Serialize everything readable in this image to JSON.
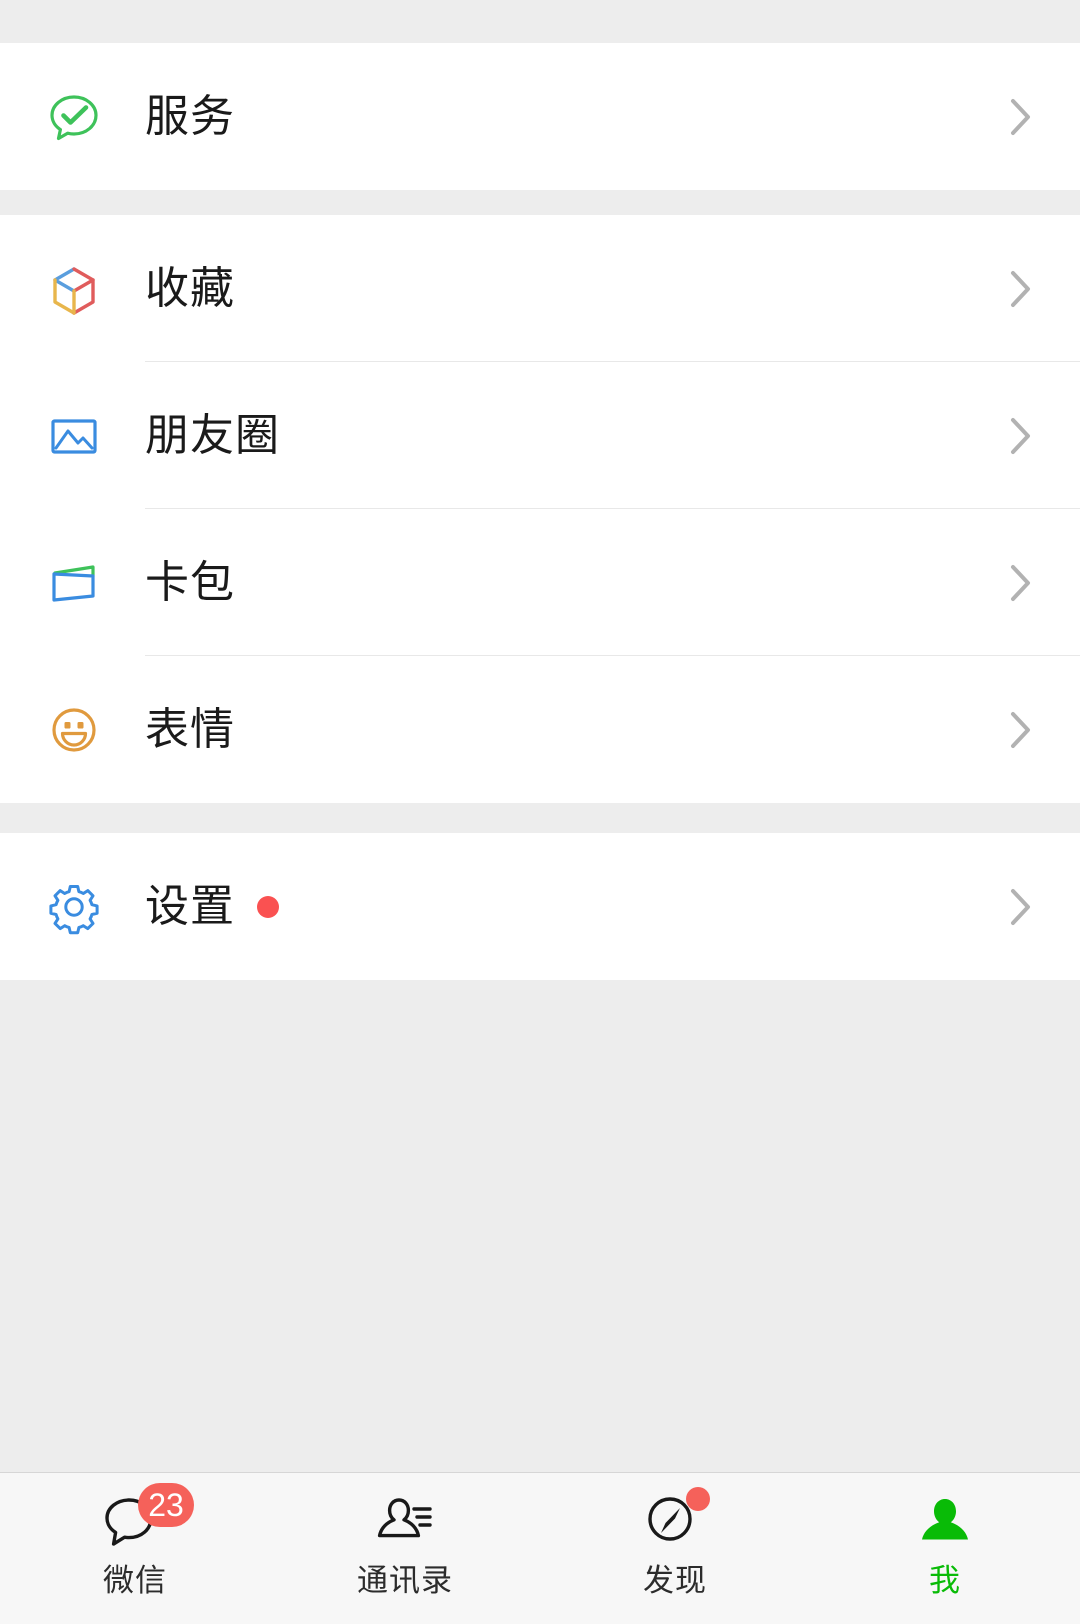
{
  "colors": {
    "page_background": "#ededed",
    "card_background": "#ffffff",
    "accent_green": "#09bb07",
    "badge_red": "#f5615a",
    "dot_red": "#fa5151",
    "icon_blue": "#3a8ce0",
    "icon_orange": "#e09a3e",
    "label_text": "#1a1a1a",
    "chevron_gray": "#b2b2b2"
  },
  "groups": [
    {
      "name": "services-group",
      "items": [
        {
          "id": "services",
          "label": "服务",
          "icon": "wechat-pay-services-icon",
          "has_chevron": true,
          "has_dot": false
        }
      ]
    },
    {
      "name": "features-group",
      "items": [
        {
          "id": "favorites",
          "label": "收藏",
          "icon": "cube-favorites-icon",
          "has_chevron": true,
          "has_dot": false
        },
        {
          "id": "moments",
          "label": "朋友圈",
          "icon": "photo-moments-icon",
          "has_chevron": true,
          "has_dot": false
        },
        {
          "id": "cards-offers",
          "label": "卡包",
          "icon": "wallet-cards-icon",
          "has_chevron": true,
          "has_dot": false
        },
        {
          "id": "stickers",
          "label": "表情",
          "icon": "smiley-stickers-icon",
          "has_chevron": true,
          "has_dot": false
        }
      ]
    },
    {
      "name": "settings-group",
      "items": [
        {
          "id": "settings",
          "label": "设置",
          "icon": "gear-settings-icon",
          "has_chevron": true,
          "has_dot": true
        }
      ]
    }
  ],
  "tabbar": {
    "tabs": [
      {
        "id": "chats",
        "label": "微信",
        "icon": "chat-bubble-icon",
        "badge": "23",
        "badge_type": "count",
        "active": false
      },
      {
        "id": "contacts",
        "label": "通讯录",
        "icon": "contacts-person-icon",
        "badge": null,
        "badge_type": "none",
        "active": false
      },
      {
        "id": "discover",
        "label": "发现",
        "icon": "compass-discover-icon",
        "badge": "",
        "badge_type": "dot",
        "active": false
      },
      {
        "id": "me",
        "label": "我",
        "icon": "person-me-icon",
        "badge": null,
        "badge_type": "none",
        "active": true
      }
    ]
  }
}
